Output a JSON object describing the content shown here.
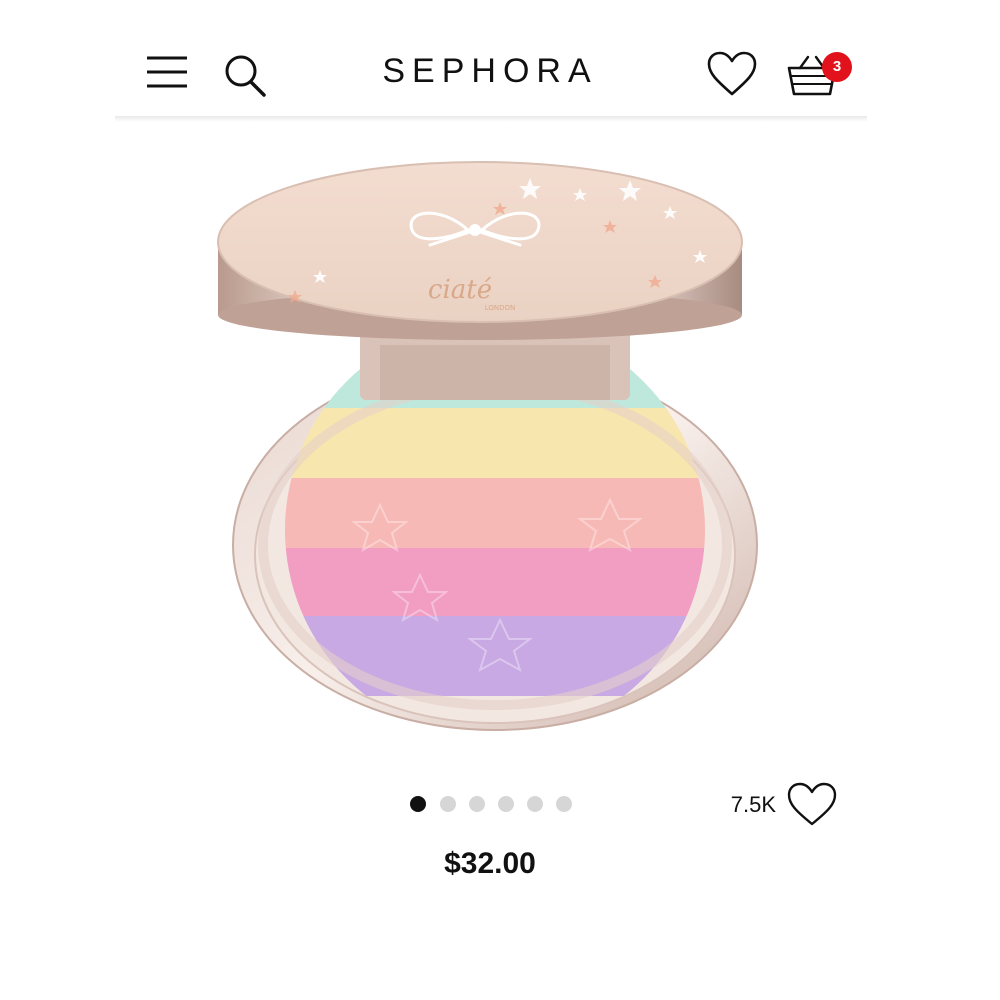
{
  "header": {
    "brand": "SEPHORA",
    "basket_count": "3",
    "icons": [
      "menu-icon",
      "search-icon",
      "heart-icon",
      "basket-icon"
    ]
  },
  "product": {
    "image_brand": "ciaté",
    "image_sub": "LONDON",
    "carousel": {
      "total": 6,
      "active": 1
    },
    "loves": "7.5K",
    "price": "$32.00"
  },
  "colors": {
    "badge": "#e1121b",
    "stripe_mint": "#bfe8dc",
    "stripe_yellow": "#f7e6ad",
    "stripe_peach": "#f7b9b5",
    "stripe_pink": "#f19ec2",
    "stripe_lilac": "#c8a9e3"
  }
}
